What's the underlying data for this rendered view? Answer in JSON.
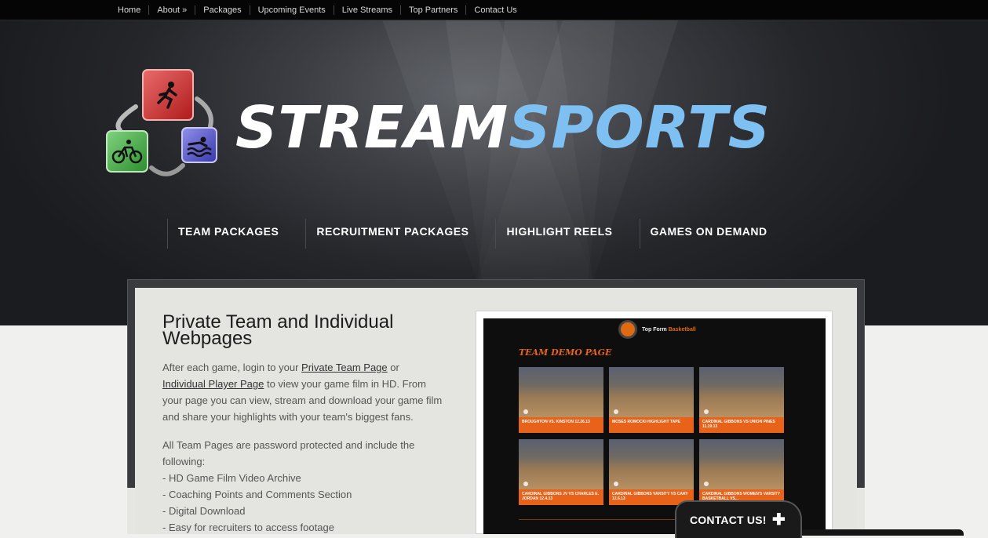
{
  "topnav": [
    {
      "label": "Home"
    },
    {
      "label": "About »"
    },
    {
      "label": "Packages"
    },
    {
      "label": "Upcoming Events"
    },
    {
      "label": "Live Streams"
    },
    {
      "label": "Top Partners"
    },
    {
      "label": "Contact Us"
    }
  ],
  "brand": {
    "part1": "STREAM",
    "part2": "SPORTS"
  },
  "mainnav": [
    {
      "label": "TEAM PACKAGES"
    },
    {
      "label": "RECRUITMENT PACKAGES"
    },
    {
      "label": "HIGHLIGHT REELS"
    },
    {
      "label": "GAMES ON DEMAND"
    }
  ],
  "content": {
    "title": "Private Team and Individual Webpages",
    "intro_before": "After each game, login to your ",
    "link1": "Private Team Page",
    "intro_mid": " or ",
    "link2": "Individual Player Page",
    "intro_after": " to view your game film in HD. From your page you can view, stream and download your game film and share your highlights with your team's biggest fans.",
    "list_intro": "All Team Pages are password protected and include the following:",
    "features": [
      "- HD Game Film Video Archive",
      "- Coaching Points and Comments Section",
      "- Digital Download",
      "- Easy for recruiters to access footage"
    ]
  },
  "demo": {
    "brand_a": "Top Form ",
    "brand_b": "Basketball",
    "heading": "TEAM DEMO PAGE",
    "thumbs": [
      "BROUGHTON VS. KINSTON 12.26.13",
      "MOSES ROMOCKI HIGHLIGHT TAPE",
      "CARDINAL GIBBONS VS UNION PINES 11.19.13",
      "CARDINAL GIBBONS JV VS CHARLES E. JORDAN 12.4.13",
      "CARDINAL GIBBONS VARSITY VS CARY 12.6.13",
      "CARDINAL GIBBONS WOMEN'S VARSITY BASKETBALL VS..."
    ]
  },
  "contact": {
    "label": "CONTACT US!",
    "plus": "✚"
  },
  "colors": {
    "accent_blue": "#7ec0f2",
    "demo_orange": "#e8621a"
  }
}
